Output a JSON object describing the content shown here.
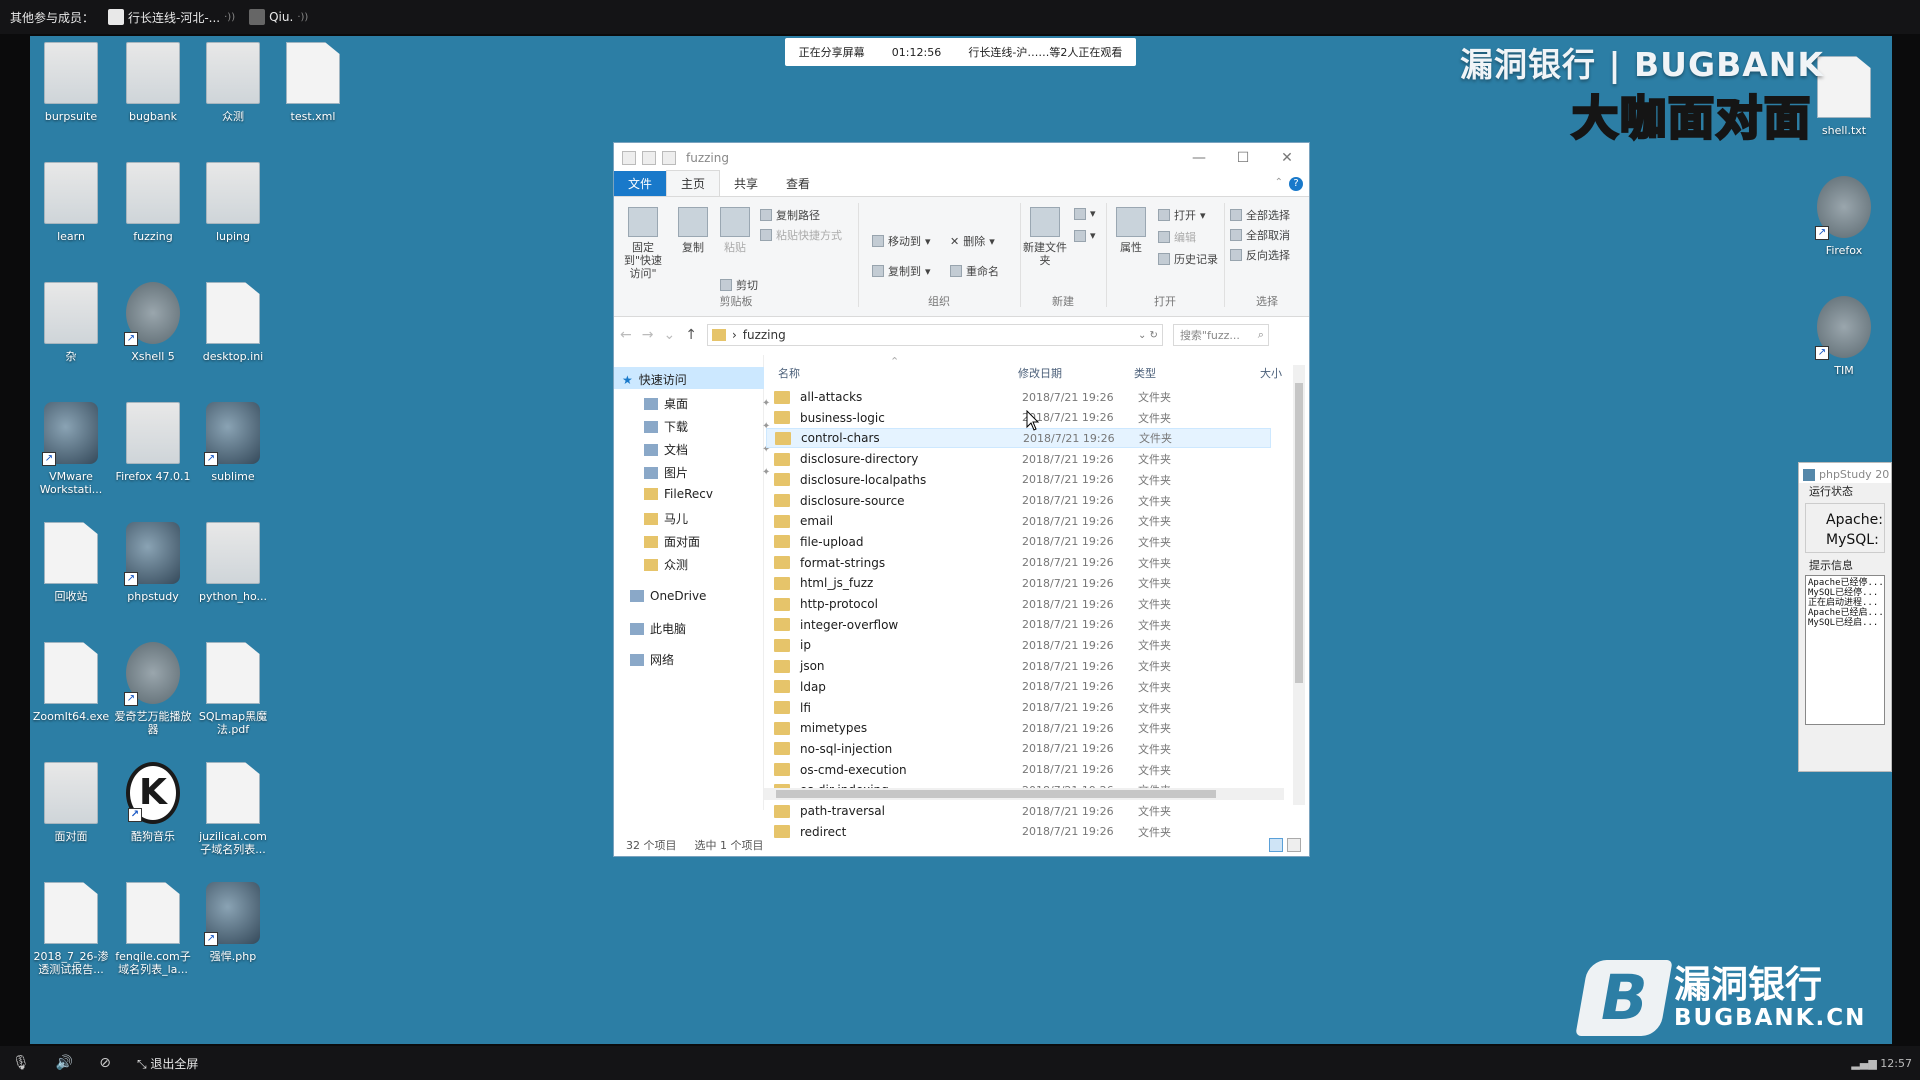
{
  "topbar": {
    "members_label": "其他参与成员：",
    "member1": "行长连线-河北-...",
    "member2": "Qiu."
  },
  "share": {
    "status": "正在分享屏幕",
    "time": "01:12:56",
    "viewers": "行长连线-沪……等2人正在观看"
  },
  "watermark": {
    "top_line1": "漏洞银行 | BUGBANK",
    "top_line2": "大咖面对面",
    "bottom_cn": "漏洞银行",
    "bottom_en": "BUGBANK.CN",
    "bottom_logo_letter": "B"
  },
  "desktop_icons": [
    {
      "label": "burpsuite",
      "kind": "folder"
    },
    {
      "label": "bugbank",
      "kind": "folder"
    },
    {
      "label": "众测",
      "kind": "folder"
    },
    {
      "label": "test.xml",
      "kind": "doc"
    },
    {
      "label": "learn",
      "kind": "folder"
    },
    {
      "label": "fuzzing",
      "kind": "folder"
    },
    {
      "label": "luping",
      "kind": "folder"
    },
    {
      "label": "杂",
      "kind": "folder"
    },
    {
      "label": "Xshell 5",
      "kind": "app-round"
    },
    {
      "label": "desktop.ini",
      "kind": "doc"
    },
    {
      "label": "VMware Workstati...",
      "kind": "app-dark"
    },
    {
      "label": "Firefox 47.0.1",
      "kind": "folder"
    },
    {
      "label": "sublime",
      "kind": "app-dark"
    },
    {
      "label": "回收站",
      "kind": "doc"
    },
    {
      "label": "phpstudy",
      "kind": "app-dark"
    },
    {
      "label": "python_ho...",
      "kind": "folder"
    },
    {
      "label": "ZoomIt64.exe",
      "kind": "doc"
    },
    {
      "label": "爱奇艺万能播放器",
      "kind": "app-round"
    },
    {
      "label": "SQLmap黑魔法.pdf",
      "kind": "doc"
    },
    {
      "label": "面对面",
      "kind": "folder"
    },
    {
      "label": "酷狗音乐",
      "kind": "app-k"
    },
    {
      "label": "juzilicai.com子域名列表...",
      "kind": "doc"
    },
    {
      "label": "2018_7_26-渗透测试报告...",
      "kind": "doc"
    },
    {
      "label": "fenqile.com子域名列表_la...",
      "kind": "doc"
    },
    {
      "label": "强悍.php",
      "kind": "app-dark"
    },
    {
      "label": "shell.txt",
      "kind": "doc"
    },
    {
      "label": "Firefox",
      "kind": "app-round"
    },
    {
      "label": "TIM",
      "kind": "app-round"
    }
  ],
  "phpstudy": {
    "title": "phpStudy 20",
    "run_status_label": "运行状态",
    "apache_label": "Apache:",
    "mysql_label": "MySQL:",
    "tips_label": "提示信息",
    "log_lines": [
      "Apache已经停...",
      "MySQL已经停...",
      "正在启动进程...",
      "Apache已经启...",
      "MySQL已经启..."
    ]
  },
  "explorer": {
    "title": "fuzzing",
    "window_controls": [
      "—",
      "☐",
      "✕"
    ],
    "tabs": [
      "文件",
      "主页",
      "共享",
      "查看"
    ],
    "ribbon": {
      "pin_quick": "固定到\"快速访问\"",
      "copy": "复制",
      "paste": "粘贴",
      "copy_path": "复制路径",
      "paste_shortcut": "粘贴快捷方式",
      "cut": "剪切",
      "group_clipboard": "剪贴板",
      "move_to": "移动到",
      "delete": "删除",
      "copy_to": "复制到",
      "rename": "重命名",
      "group_organize": "组织",
      "new_folder": "新建文件夹",
      "group_new": "新建",
      "properties": "属性",
      "open": "打开",
      "edit": "编辑",
      "history": "历史记录",
      "group_open": "打开",
      "select_all": "全部选择",
      "select_none": "全部取消",
      "invert_selection": "反向选择",
      "group_select": "选择"
    },
    "address": "fuzzing",
    "search_placeholder": "搜索\"fuzz...",
    "nav": {
      "quick_access": "快速访问",
      "desktop": "桌面",
      "downloads": "下载",
      "documents": "文档",
      "pictures": "图片",
      "filerecv": "FileRecv",
      "maer": "马儿",
      "mianduimian": "面对面",
      "zhongce": "众测",
      "onedrive": "OneDrive",
      "this_pc": "此电脑",
      "network": "网络"
    },
    "columns": {
      "name": "名称",
      "date": "修改日期",
      "type": "类型",
      "size": "大小"
    },
    "files": [
      {
        "name": "all-attacks",
        "date": "2018/7/21 19:26",
        "type": "文件夹"
      },
      {
        "name": "business-logic",
        "date": "2018/7/21 19:26",
        "type": "文件夹"
      },
      {
        "name": "control-chars",
        "date": "2018/7/21 19:26",
        "type": "文件夹"
      },
      {
        "name": "disclosure-directory",
        "date": "2018/7/21 19:26",
        "type": "文件夹"
      },
      {
        "name": "disclosure-localpaths",
        "date": "2018/7/21 19:26",
        "type": "文件夹"
      },
      {
        "name": "disclosure-source",
        "date": "2018/7/21 19:26",
        "type": "文件夹"
      },
      {
        "name": "email",
        "date": "2018/7/21 19:26",
        "type": "文件夹"
      },
      {
        "name": "file-upload",
        "date": "2018/7/21 19:26",
        "type": "文件夹"
      },
      {
        "name": "format-strings",
        "date": "2018/7/21 19:26",
        "type": "文件夹"
      },
      {
        "name": "html_js_fuzz",
        "date": "2018/7/21 19:26",
        "type": "文件夹"
      },
      {
        "name": "http-protocol",
        "date": "2018/7/21 19:26",
        "type": "文件夹"
      },
      {
        "name": "integer-overflow",
        "date": "2018/7/21 19:26",
        "type": "文件夹"
      },
      {
        "name": "ip",
        "date": "2018/7/21 19:26",
        "type": "文件夹"
      },
      {
        "name": "json",
        "date": "2018/7/21 19:26",
        "type": "文件夹"
      },
      {
        "name": "ldap",
        "date": "2018/7/21 19:26",
        "type": "文件夹"
      },
      {
        "name": "lfi",
        "date": "2018/7/21 19:26",
        "type": "文件夹"
      },
      {
        "name": "mimetypes",
        "date": "2018/7/21 19:26",
        "type": "文件夹"
      },
      {
        "name": "no-sql-injection",
        "date": "2018/7/21 19:26",
        "type": "文件夹"
      },
      {
        "name": "os-cmd-execution",
        "date": "2018/7/21 19:26",
        "type": "文件夹"
      },
      {
        "name": "os-dir-indexing",
        "date": "2018/7/21 19:26",
        "type": "文件夹"
      },
      {
        "name": "path-traversal",
        "date": "2018/7/21 19:26",
        "type": "文件夹"
      },
      {
        "name": "redirect",
        "date": "2018/7/21 19:26",
        "type": "文件夹"
      }
    ],
    "selected_row": 2,
    "status_items": "32 个项目",
    "status_selected": "选中 1 个项目"
  },
  "bottombar": {
    "exit_fullscreen": "退出全屏",
    "clock": "12:57"
  },
  "colors": {
    "desktop": "#2c7ea5",
    "bar": "#141416",
    "accent": "#1979ca"
  }
}
